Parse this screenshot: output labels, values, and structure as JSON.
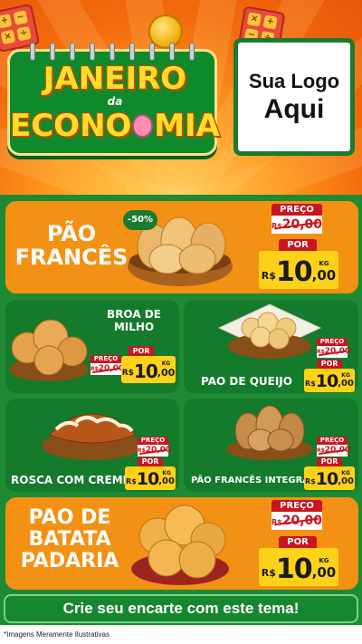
{
  "header": {
    "title_line1": "JANEIRO",
    "title_mid": "da",
    "title_line2_a": "ECONO",
    "title_line2_b": "MIA",
    "logo_line1": "Sua Logo",
    "logo_line2": "Aqui"
  },
  "colors": {
    "orange": "#f39114",
    "green": "#147a2c",
    "red": "#c9151e",
    "yellow": "#ffd21a"
  },
  "products": {
    "pao_frances": {
      "name_line1": "PÃO",
      "name_line2": "FRANCÊS",
      "discount": "-50%",
      "preco_label": "PREÇO",
      "old_cur": "R$",
      "old_price": "20,00",
      "por_label": "POR",
      "cur": "R$",
      "price_int": "10",
      "price_dec": ",00",
      "unit": "KG"
    },
    "broa": {
      "name_line1": "BROA DE",
      "name_line2": "MILHO",
      "preco_label": "PREÇO",
      "old_cur": "R$",
      "old_price": "20,00",
      "por_label": "POR",
      "cur": "R$",
      "price_int": "10",
      "price_dec": ",00",
      "unit": "KG"
    },
    "pao_queijo": {
      "name": "PAO DE QUEIJO",
      "preco_label": "PREÇO",
      "old_cur": "R$",
      "old_price": "20,00",
      "por_label": "POR",
      "cur": "R$",
      "price_int": "10",
      "price_dec": ",00",
      "unit": "KG"
    },
    "rosca": {
      "name": "ROSCA COM CREME",
      "preco_label": "PREÇO",
      "old_cur": "R$",
      "old_price": "20,00",
      "por_label": "POR",
      "cur": "R$",
      "price_int": "10",
      "price_dec": ",00",
      "unit": "KG"
    },
    "pao_integral": {
      "name": "PÃO FRANCÊS INTEGRAL",
      "preco_label": "PREÇO",
      "old_cur": "R$",
      "old_price": "20,00",
      "por_label": "POR",
      "cur": "R$",
      "price_int": "10",
      "price_dec": ",00",
      "unit": "KG"
    },
    "pao_batata": {
      "name_line1": "PAO DE",
      "name_line2": "BATATA",
      "name_line3": "PADARIA",
      "preco_label": "PREÇO",
      "old_cur": "R$",
      "old_price": "20,00",
      "por_label": "POR",
      "cur": "R$",
      "price_int": "10",
      "price_dec": ",00",
      "unit": "KG"
    }
  },
  "cta": "Crie seu encarte com este tema!",
  "footer": "*Imagens Meramente Ilustrativas"
}
